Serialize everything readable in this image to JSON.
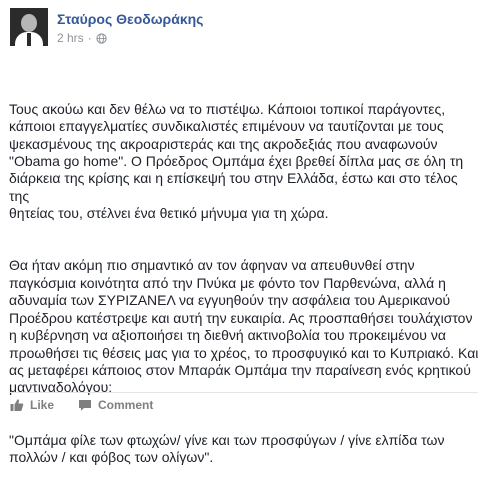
{
  "post": {
    "author": "Σταύρος Θεοδωράκης",
    "time": "2 hrs",
    "separator": "·",
    "paragraphs": [
      "Τους ακούω και δεν θέλω να το πιστέψω. Κάποιοι τοπικοί παράγοντες,\nκάποιοι επαγγελματίες συνδικαλιστές επιμένουν να ταυτίζονται με τους\nψεκασμένους της ακροαριστεράς και της ακροδεξιάς που αναφωνούν\n\"Obama go home\". Ο Πρόεδρος Ομπάμα έχει βρεθεί δίπλα μας σε όλη τη\nδιάρκεια της κρίσης και η επίσκεψή του στην Ελλάδα, έστω και στο τέλος της\nθητείας του, στέλνει ένα θετικό μήνυμα για τη χώρα.",
      "Θα ήταν ακόμη πιο σημαντικό αν τον άφηναν να απευθυνθεί στην\nπαγκόσμια κοινότητα από την Πνύκα με φόντο τον Παρθενώνα, αλλά η\nαδυναμία των ΣΥΡΙΖΑΝΕΛ να εγγυηθούν την ασφάλεια του Αμερικανού\nΠροέδρου κατέστρεψε και αυτή την ευκαιρία. Ας προσπαθήσει τουλάχιστον\nη κυβέρνηση να αξιοποιήσει τη διεθνή ακτινοβολία του προκειμένου να\nπροωθήσει τις θέσεις μας για το χρέος, το προσφυγικό και το Κυπριακό. Και\nας μεταφέρει κάποιος στον Μπαράκ Ομπάμα την παραίνεση ενός κρητικού\nμαντιναδολόγου:",
      "\"Ομπάμα φίλε των φτωχών/ γίνε και των προσφύγων / γίνε ελπίδα των\nπολλών / και φόβος των ολίγων\"."
    ]
  },
  "actions": {
    "like": "Like",
    "comment": "Comment"
  },
  "icons": {
    "privacy": "globe-icon",
    "like": "thumbs-up-icon",
    "comment": "speech-bubble-icon"
  },
  "colors": {
    "author": "#365899",
    "meta": "#90949c",
    "action": "#7f7f7f"
  }
}
